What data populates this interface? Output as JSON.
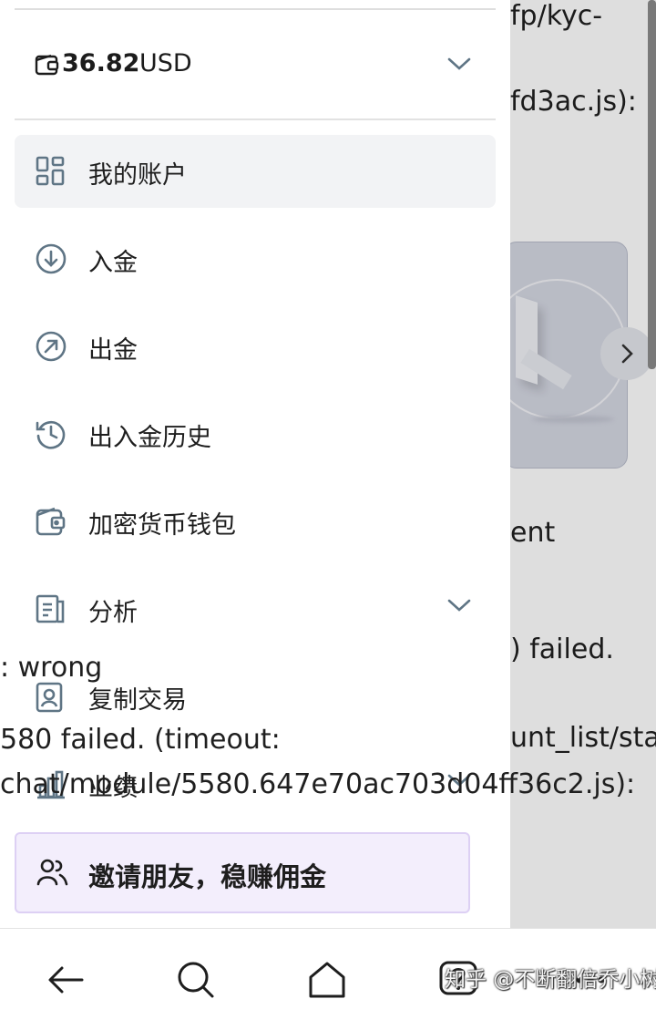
{
  "background": {
    "lines": [
      "fp/kyc-",
      "fd3ac.js):",
      "ent",
      ") failed.",
      "unt_list/stat"
    ]
  },
  "drawer": {
    "balance": {
      "amount": "36.82",
      "currency": "USD",
      "icon": "wallet-icon"
    },
    "menu": [
      {
        "label": "我的账户",
        "icon": "dashboard-icon",
        "active": true
      },
      {
        "label": "入金",
        "icon": "arrow-down-circle-icon"
      },
      {
        "label": "出金",
        "icon": "arrow-up-right-circle-icon"
      },
      {
        "label": "出入金历史",
        "icon": "history-icon"
      },
      {
        "label": "加密货币钱包",
        "icon": "crypto-wallet-icon"
      },
      {
        "label": "分析",
        "icon": "analysis-icon",
        "expandable": true
      },
      {
        "label": "复制交易",
        "icon": "copy-trade-icon"
      },
      {
        "label": "业绩",
        "icon": "bar-chart-icon",
        "expandable": true
      }
    ],
    "invite": {
      "label": "邀请朋友，稳赚佣金",
      "icon": "users-icon"
    }
  },
  "overlay_text": [
    ": wrong",
    "580 failed. (timeout:",
    "chat/module/5580.647e70ac703d04ff36c2.js):"
  ],
  "navbar": {
    "buttons": [
      "back-icon",
      "search-icon",
      "home-icon",
      "help-icon",
      "more-icon"
    ],
    "watermark": "知乎 @不断翻倍乔小树"
  },
  "colors": {
    "icon": "#5f7585",
    "invite_bg": "#f3eefc",
    "active_bg": "#f2f3f5"
  }
}
